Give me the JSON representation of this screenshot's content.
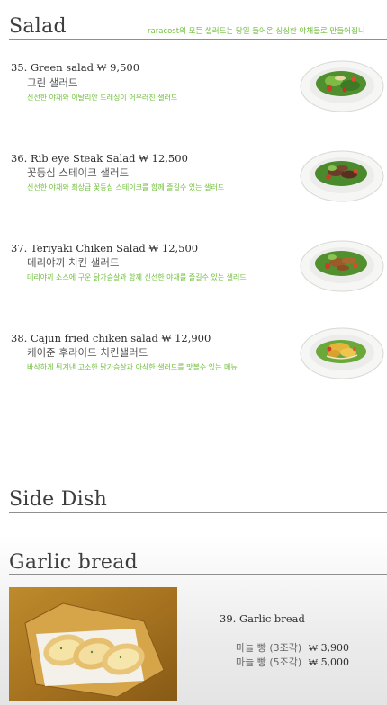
{
  "salad": {
    "title": "Salad",
    "tagline": "raracost의 모든 샐러드는 당일 들어온 싱싱한 야채들로 만들어집니",
    "items": [
      {
        "name": "35. Green salad  ₩ 9,500",
        "korean": "그린 샐러드",
        "desc": "신선한 야채와 이탈리안 드레싱이 어우러진 샐러드",
        "image": "green-salad-plate"
      },
      {
        "name": "36. Rib eye Steak Salad  ₩ 12,500",
        "korean": "꽃등심 스테이크 샐러드",
        "desc": "신선한 야채와 최상급 꽃등심 스테이크를 함께 즐길수 있는 샐러드",
        "image": "steak-salad-plate"
      },
      {
        "name": "37. Teriyaki Chiken Salad  ₩ 12,500",
        "korean": "데리야끼 치킨 샐러드",
        "desc": "데리야끼 소스에 구운 닭가슴살과 함께 신선한 야채를 즐길수 있는 샐러드",
        "image": "teriyaki-salad-plate"
      },
      {
        "name": "38. Cajun fried chiken salad  ₩ 12,900",
        "korean": "케이준 후라이드 치킨샐러드",
        "desc": "바삭하게 튀겨낸 고소한 닭가슴살과 아삭한 샐러드를 맛볼수 있는 메뉴",
        "image": "cajun-salad-plate"
      }
    ]
  },
  "side_dish": {
    "title": "Side Dish"
  },
  "garlic_bread": {
    "title": "Garlic bread",
    "item_name": "39. Garlic bread",
    "prices": [
      {
        "label": "마늘 빵 (3조각)",
        "price": "₩ 3,900"
      },
      {
        "label": "마늘 빵 (5조각)",
        "price": "₩ 5,000"
      }
    ],
    "image": "garlic-bread-photo"
  },
  "colors": {
    "accent_green": "#6fbf3a",
    "rule": "#8f8f8f"
  }
}
